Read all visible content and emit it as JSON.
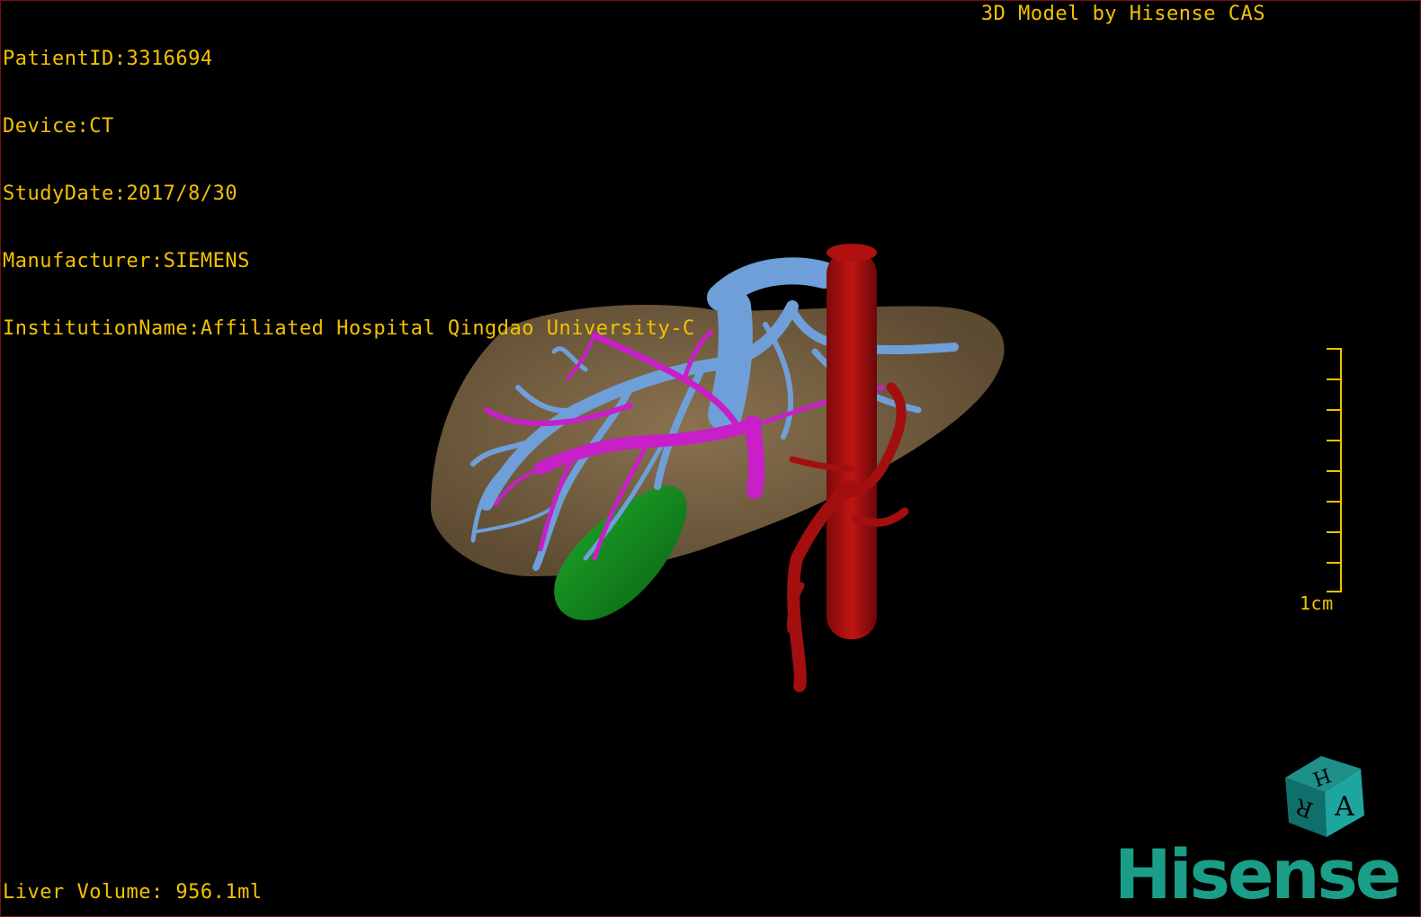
{
  "patient_info": {
    "patient_id": "PatientID:3316694",
    "device": "Device:CT",
    "study_date": "StudyDate:2017/8/30",
    "manufacturer": "Manufacturer:SIEMENS",
    "institution": "InstitutionName:Affiliated Hospital Qingdao University-C"
  },
  "model_credit": "3D Model by Hisense CAS",
  "liver_volume": "Liver Volume: 956.1ml",
  "scale_bar": {
    "label": "1cm"
  },
  "orientation_cube": {
    "front_label": "A",
    "top_label": "H",
    "side_label": "R"
  },
  "brand": "Hisense",
  "colors": {
    "overlay_text": "#f2c200",
    "liver": "#7a6344",
    "portal_vein": "#6f9fd8",
    "hepatic_vessels": "#c81fc8",
    "gallbladder": "#0f8a1c",
    "aorta": "#a30f0f",
    "brand": "#1b9e88",
    "frame_border": "#7a0f12"
  }
}
